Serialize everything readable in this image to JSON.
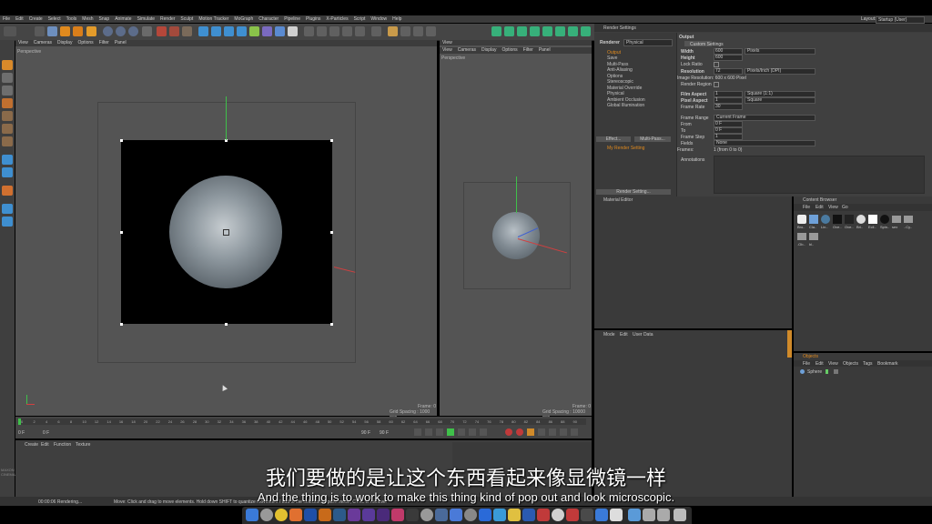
{
  "app": {
    "menu": [
      "File",
      "Edit",
      "Create",
      "Select",
      "Tools",
      "Mesh",
      "Snap",
      "Animate",
      "Simulate",
      "Render",
      "Sculpt",
      "Motion Tracker",
      "MoGraph",
      "Character",
      "Pipeline",
      "Plugins",
      "X-Particles",
      "Script",
      "Window",
      "Help"
    ],
    "layout_label": "Layout:",
    "layout_value": "Startup (User)"
  },
  "viewport_main": {
    "menu": [
      "View",
      "Cameras",
      "Display",
      "Options",
      "Filter",
      "Panel"
    ],
    "label": "Perspective",
    "frame": "Frame: 0",
    "grid": "Grid Spacing : 1000 mm"
  },
  "viewport_view": {
    "title": "View",
    "menu": [
      "View",
      "Cameras",
      "Display",
      "Options",
      "Filter",
      "Panel"
    ],
    "label": "Perspective",
    "frame": "Frame: 0",
    "grid": "Grid Spacing : 10000 mm"
  },
  "render_settings": {
    "title": "Render Settings",
    "renderer_label": "Renderer",
    "renderer_value": "Physical",
    "items": [
      "Output",
      "Save",
      "Multi-Pass",
      "Anti-Aliasing",
      "Options",
      "Stereoscopic",
      "Material Override",
      "Physical",
      "Ambient Occlusion",
      "Global Illumination"
    ],
    "effect_button": "Effect...",
    "multipass_button": "Multi-Pass...",
    "setting_name": "My Render Setting",
    "render_setting_button": "Render Setting...",
    "output_header": "Output",
    "custom_settings": "Custom Settings",
    "width_label": "Width",
    "width_value": "600",
    "width_unit": "Pixels",
    "height_label": "Height",
    "height_value": "600",
    "lock_ratio": "Lock Ratio",
    "resolution_label": "Resolution",
    "resolution_value": "72",
    "resolution_unit": "Pixels/Inch (DPI)",
    "image_resolution": "Image Resolution: 600 x 600 Pixel",
    "render_region": "Render Region",
    "film_aspect_label": "Film Aspect",
    "film_aspect_value": "1",
    "film_aspect_preset": "Square (1:1)",
    "pixel_aspect_label": "Pixel Aspect",
    "pixel_aspect_value": "1",
    "pixel_aspect_preset": "Square",
    "frame_rate_label": "Frame Rate",
    "frame_rate_value": "30",
    "frame_range_label": "Frame Range",
    "frame_range_value": "Current Frame",
    "from_label": "From",
    "from_value": "0 F",
    "to_label": "To",
    "to_value": "0 F",
    "frame_step_label": "Frame Step",
    "frame_step_value": "1",
    "fields_label": "Fields",
    "fields_value": "None",
    "frames_label": "Frames:",
    "frames_value": "1 (from 0 to 0)",
    "annotations_label": "Annotations"
  },
  "material_editor": {
    "title": "Material Editor"
  },
  "content_browser": {
    "title": "Content Browser",
    "menu": [
      "File",
      "Edit",
      "View",
      "Go"
    ],
    "thumbs": [
      "Bro..",
      "Cla..",
      "Lin..",
      "Ove..",
      "Ove..",
      "Bri..",
      "Ecli..",
      "Spin..",
      "sex",
      "..Cy..",
      ".Ob..",
      "bl.."
    ]
  },
  "attributes": {
    "menu": [
      "Mode",
      "Edit",
      "User Data"
    ]
  },
  "objects": {
    "title": "Objects",
    "menu": [
      "File",
      "Edit",
      "View",
      "Objects",
      "Tags",
      "Bookmark"
    ],
    "item": "Sphere"
  },
  "timeline": {
    "ticks": [
      "0",
      "2",
      "4",
      "6",
      "8",
      "10",
      "12",
      "14",
      "16",
      "18",
      "20",
      "22",
      "24",
      "26",
      "28",
      "30",
      "32",
      "34",
      "36",
      "38",
      "40",
      "42",
      "44",
      "46",
      "48",
      "50",
      "52",
      "54",
      "56",
      "58",
      "60",
      "62",
      "64",
      "66",
      "68",
      "70",
      "72",
      "74",
      "76",
      "78",
      "80",
      "82",
      "84",
      "86",
      "88",
      "90"
    ],
    "current": "0 F",
    "start": "0 F",
    "end": "90 F",
    "end2": "90 F",
    "out": "0 F"
  },
  "material_manager": {
    "menu": [
      "Create",
      "Edit",
      "Function",
      "Texture"
    ]
  },
  "status": {
    "time": "00:00:06 Rendering...",
    "hint": "Move: Click and drag to move elements. Hold down SHIFT to quantize movement / add to the selection in point mode, CTRL to remove."
  },
  "logo": "MAXON CINEMA4D",
  "subtitles": {
    "chinese": "我们要做的是让这个东西看起来像显微镜一样",
    "english": "And the thing is to work to make this thing kind of pop out and look microscopic."
  },
  "colors": {
    "accent": "#e08a1e",
    "viewport": "#545454",
    "sphere": "#8a96a0"
  }
}
